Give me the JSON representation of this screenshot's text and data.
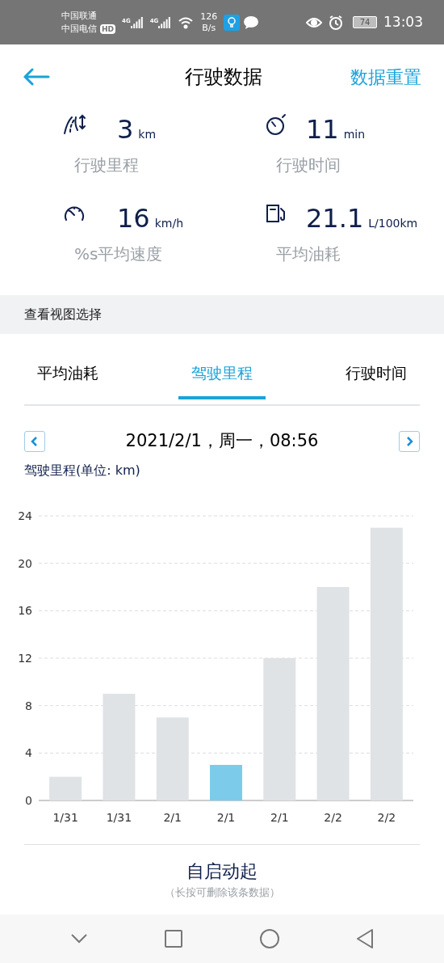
{
  "status_bar": {
    "carrier_1": "中国联通",
    "carrier_2": "中国电信",
    "hd_badge": "HD",
    "net_1": "4G",
    "net_2": "4G",
    "speed_value": "126",
    "speed_unit": "B/s",
    "battery": "74",
    "time": "13:03"
  },
  "header": {
    "title": "行驶数据",
    "action": "数据重置"
  },
  "stats": [
    {
      "kind": "distance",
      "value": "3",
      "unit": "km",
      "label": "行驶里程"
    },
    {
      "kind": "time",
      "value": "11",
      "unit": "min",
      "label": "行驶时间"
    },
    {
      "kind": "speed",
      "value": "16",
      "unit": "km/h",
      "label": "%s平均速度"
    },
    {
      "kind": "fuel",
      "value": "21.1",
      "unit": "L/100km",
      "label": "平均油耗"
    }
  ],
  "section_title": "查看视图选择",
  "tabs": [
    {
      "label": "平均油耗",
      "selected": false
    },
    {
      "label": "驾驶里程",
      "selected": true
    },
    {
      "label": "行驶时间",
      "selected": false
    }
  ],
  "date_nav": {
    "date": "2021/2/1，周一，08:56"
  },
  "chart": {
    "label": "驾驶里程(单位: km)",
    "bars": [
      {
        "selected": false
      },
      {
        "selected": false
      },
      {
        "selected": false
      },
      {
        "selected": true
      },
      {
        "selected": false
      },
      {
        "selected": false
      },
      {
        "selected": false
      }
    ],
    "chart_data": {
      "type": "bar",
      "categories": [
        "1/31",
        "1/31",
        "2/1",
        "2/1",
        "2/1",
        "2/2",
        "2/2"
      ],
      "series": [
        {
          "values": [
            2,
            9,
            7,
            3,
            12,
            18,
            23
          ]
        }
      ],
      "grid": true,
      "ylim": [
        0,
        24
      ],
      "yticks": [
        0,
        4,
        8,
        12,
        16,
        20,
        24
      ]
    }
  },
  "trip": {
    "title": "自启动起",
    "hint": "（长按可删除该条数据）"
  }
}
